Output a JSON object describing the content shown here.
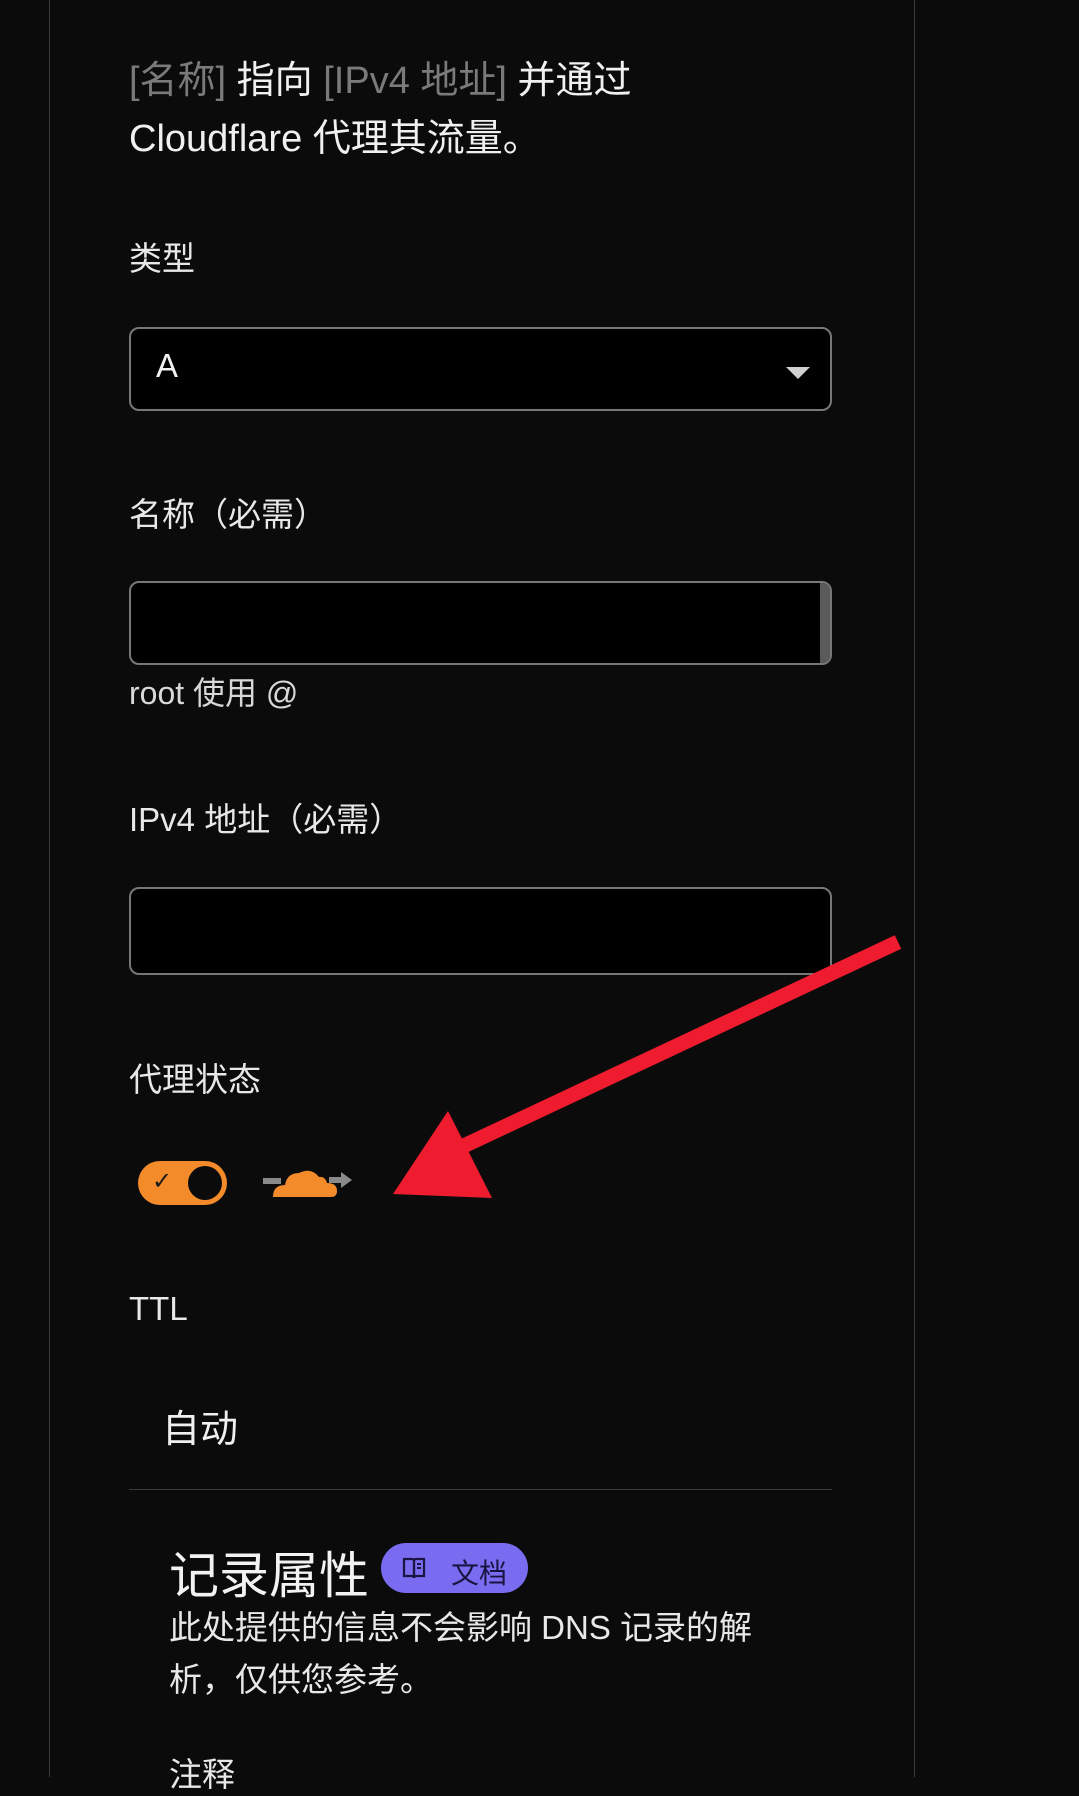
{
  "description": {
    "name_placeholder": "[名称]",
    "points_to": " 指向 ",
    "ip_placeholder": "[IPv4 地址]",
    "and_via": " 并通过 ",
    "line2": "Cloudflare 代理其流量。"
  },
  "type_field": {
    "label": "类型",
    "value": "A"
  },
  "name_field": {
    "label": "名称（必需）",
    "value": "",
    "hint": "root 使用 @"
  },
  "ipv4_field": {
    "label": "IPv4 地址（必需）",
    "value": ""
  },
  "proxy_status": {
    "label": "代理状态",
    "enabled": true,
    "toggle_icon": "check-icon",
    "status_icon": "cloudflare-proxied-cloud-icon"
  },
  "ttl_field": {
    "label": "TTL",
    "value": "自动"
  },
  "record_attributes": {
    "title": "记录属性",
    "docs_badge": "文档",
    "docs_icon": "book-icon",
    "description": "此处提供的信息不会影响 DNS 记录的解析，仅供您参考。",
    "notes_label": "注释"
  },
  "colors": {
    "background": "#0b0b0c",
    "toggle_on": "#f38b2a",
    "cloud": "#f38b2a",
    "docs_badge": "#7a6cf0",
    "annotation_arrow": "#ee1c2e"
  }
}
